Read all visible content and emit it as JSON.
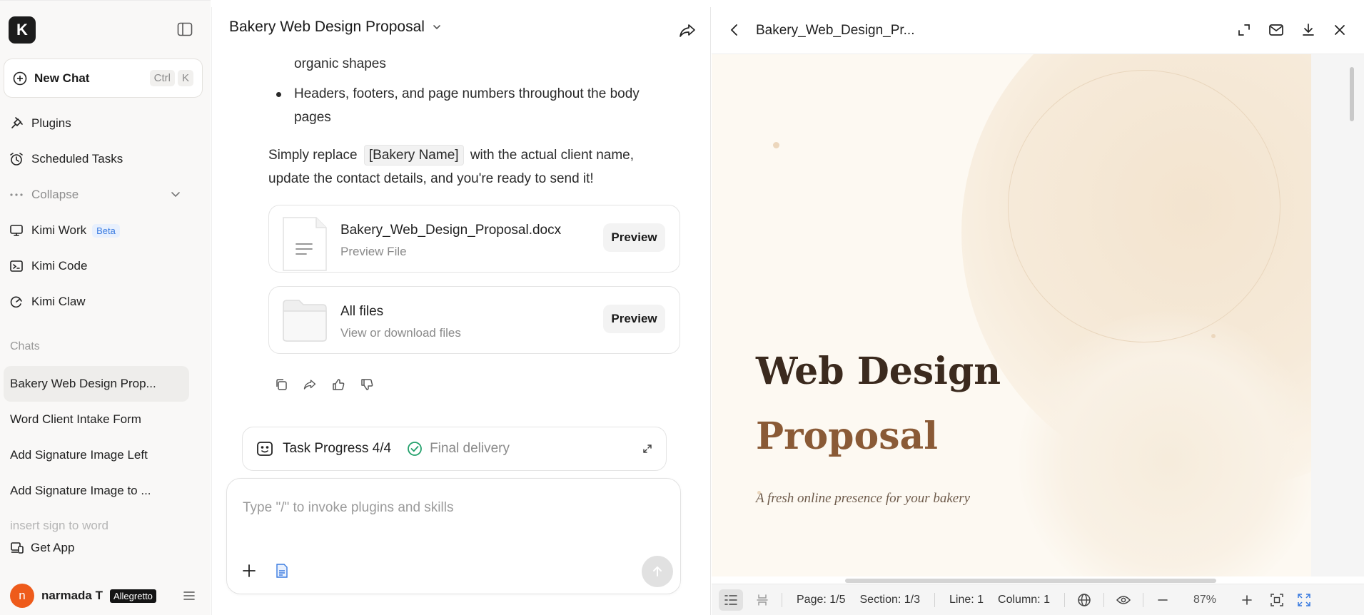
{
  "sidebar": {
    "logo_letter": "K",
    "new_chat": {
      "label": "New Chat",
      "shortcut_ctrl": "Ctrl",
      "shortcut_key": "K"
    },
    "nav": [
      {
        "label": "Plugins",
        "icon": "plug-icon"
      },
      {
        "label": "Scheduled Tasks",
        "icon": "alarm-clock-icon"
      },
      {
        "label": "Collapse",
        "icon": "ellipsis-icon"
      },
      {
        "label": "Kimi Work",
        "icon": "monitor-icon",
        "badge": "Beta"
      },
      {
        "label": "Kimi Code",
        "icon": "code-terminal-icon"
      },
      {
        "label": "Kimi Claw",
        "icon": "claw-icon"
      }
    ],
    "chats_label": "Chats",
    "chats": [
      "Bakery Web Design Prop...",
      "Word Client Intake Form",
      "Add Signature Image Left",
      "Add Signature Image to ...",
      "insert sign to word"
    ],
    "get_app": "Get App",
    "user": {
      "initial": "n",
      "name": "narmada T",
      "plan": "Allegretto"
    }
  },
  "chat": {
    "title": "Bakery Web Design Proposal",
    "lines": {
      "top_fragment": "organic shapes",
      "bullet": "Headers, footers, and page numbers throughout the body pages",
      "para_prefix": "Simply replace",
      "para_tag": "[Bakery Name]",
      "para_suffix": "with the actual client name,",
      "para_line2": "update the contact details, and you're ready to send it!"
    },
    "files": [
      {
        "name": "Bakery_Web_Design_Proposal.docx",
        "sub": "Preview File",
        "button": "Preview"
      },
      {
        "name": "All files",
        "sub": "View or download files",
        "button": "Preview"
      }
    ],
    "task": {
      "label": "Task Progress 4/4",
      "status": "Final delivery"
    },
    "composer": {
      "placeholder": "Type \"/\" to invoke plugins and skills"
    }
  },
  "preview": {
    "file_title": "Bakery_Web_Design_Pr...",
    "doc": {
      "title_line1": "Web Design",
      "title_line2": "Proposal",
      "subtitle": "A fresh online presence for your bakery"
    },
    "status": {
      "page": "Page: 1/5",
      "section": "Section: 1/3",
      "line": "Line: 1",
      "column": "Column: 1",
      "zoom": "87%"
    }
  },
  "colors": {
    "accent_beta": "#3a7be0",
    "avatar": "#ee5b1b",
    "title_dark": "#3b2a1e",
    "title_brown": "#8a5a36",
    "success": "#22a06b"
  }
}
